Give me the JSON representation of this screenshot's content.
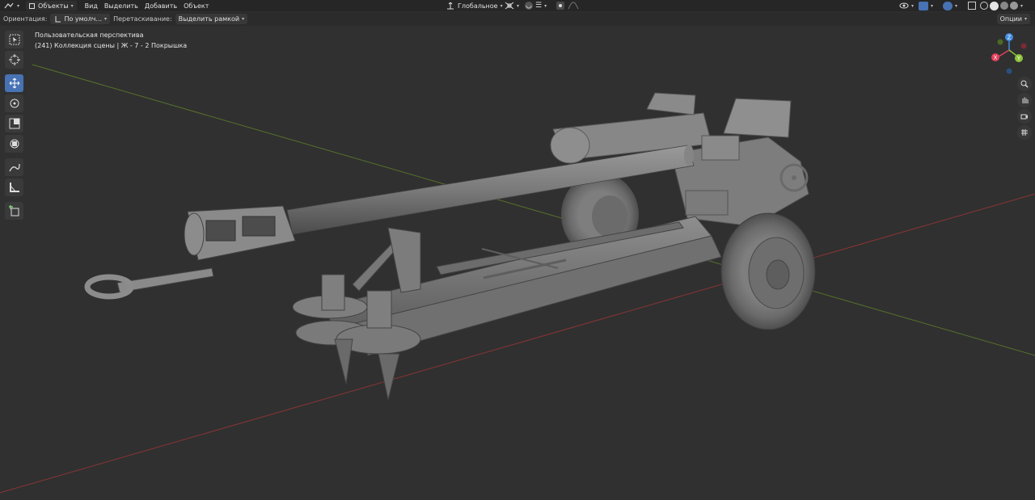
{
  "header": {
    "mode_label": "Объекты",
    "menus": [
      "Вид",
      "Выделить",
      "Добавить",
      "Объект"
    ],
    "transform_orientation": "Глобальное"
  },
  "tool_settings": {
    "orientation_label": "Ориентация:",
    "orientation_value": "По умолч...",
    "drag_label": "Перетаскивание:",
    "drag_value": "Выделить рамкой",
    "options_label": "Опции"
  },
  "viewport": {
    "view_name": "Пользовательская перспектива",
    "collection_info": "(241) Коллекция сцены | Ж - 7 - 2 Покрышка"
  },
  "tools": [
    {
      "name": "select-box-tool",
      "icon": "cursor-box"
    },
    {
      "name": "cursor-tool",
      "icon": "3d-cursor"
    },
    {
      "name": "move-tool",
      "icon": "move-arrows",
      "active": true
    },
    {
      "name": "rotate-tool",
      "icon": "rotate"
    },
    {
      "name": "scale-tool",
      "icon": "scale"
    },
    {
      "name": "transform-tool",
      "icon": "transform"
    },
    {
      "name": "annotate-tool",
      "icon": "pencil"
    },
    {
      "name": "measure-tool",
      "icon": "ruler"
    },
    {
      "name": "add-cube-tool",
      "icon": "add-cube"
    }
  ],
  "gizmo": {
    "axis_x": "X",
    "axis_y": "Y",
    "axis_z": "Z",
    "color_x": "#e0405a",
    "color_y": "#8cc43a",
    "color_z": "#3f8ce0"
  },
  "colors": {
    "viewport_bg": "#303030",
    "active_tool": "#4772b3",
    "axis_red": "#9a3a3a",
    "axis_green": "#5e7a2a"
  }
}
